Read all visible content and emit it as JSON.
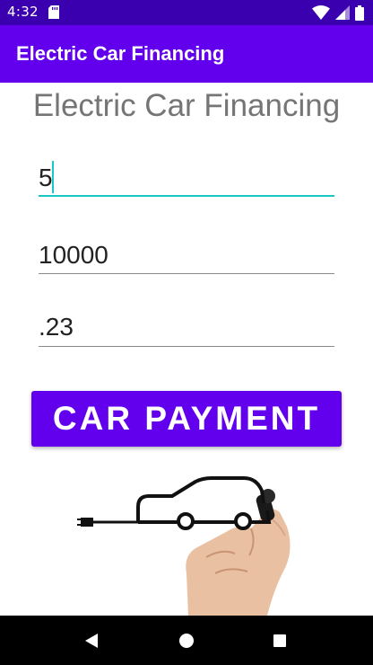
{
  "status_bar": {
    "time": "4:32",
    "icons": [
      "sd-card-icon",
      "wifi-icon",
      "signal-icon",
      "battery-icon"
    ]
  },
  "app_bar": {
    "title": "Electric Car Financing"
  },
  "main": {
    "heading": "Electric Car Financing",
    "years_field": {
      "value": "5"
    },
    "amount_field": {
      "value": "10000"
    },
    "rate_field": {
      "value": ".23"
    },
    "payment_button": {
      "label": "CAR PAYMENT"
    },
    "illustration": {
      "name": "hand-drawing-electric-car"
    }
  },
  "nav_bar": {
    "buttons": [
      "back-icon",
      "home-icon",
      "recents-icon"
    ]
  },
  "colors": {
    "primary": "#6200ee",
    "primary_dark": "#3a00b0",
    "accent": "#1bc6c6"
  }
}
